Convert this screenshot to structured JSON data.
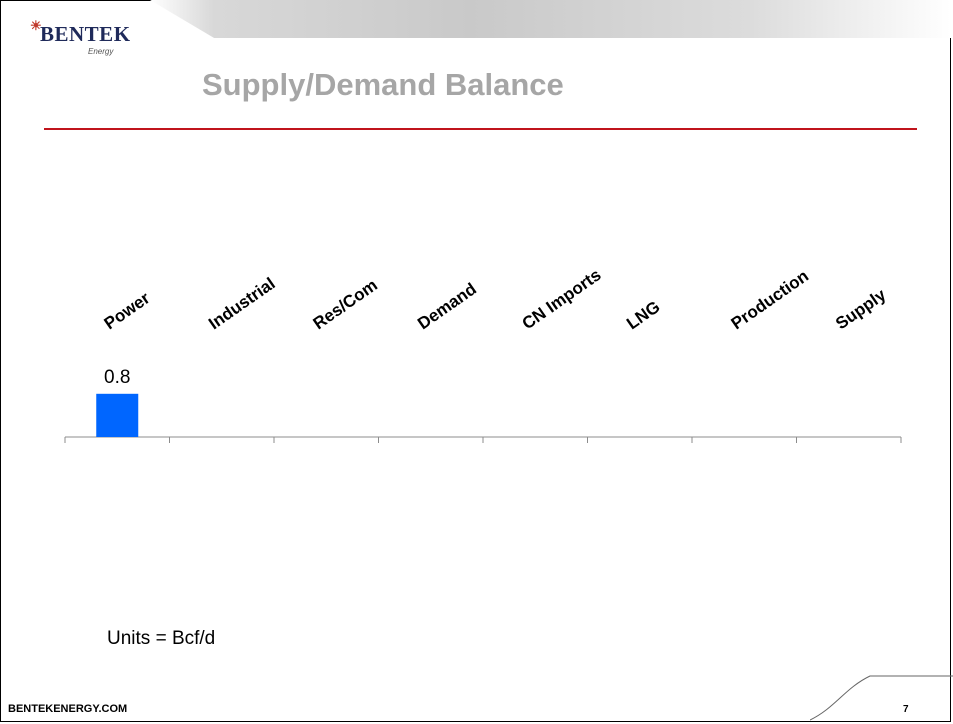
{
  "slide": {
    "logo_word": "BENTEK",
    "logo_sub": "Energy",
    "title": "Supply/Demand Balance",
    "units": "Units = Bcf/d",
    "footer_url": "BENTEKENERGY.COM",
    "page_number": "7"
  },
  "colors": {
    "bar": "#0066ff",
    "title": "#a6a6a6",
    "rule": "#c0141c"
  },
  "chart_data": {
    "type": "bar",
    "categories": [
      "Power",
      "Industrial",
      "Res/Com",
      "Demand",
      "CN Imports",
      "LNG",
      "Production",
      "Supply"
    ],
    "values": [
      0.8,
      null,
      null,
      null,
      null,
      null,
      null,
      null
    ],
    "data_labels": [
      "0.8",
      "",
      "",
      "",
      "",
      "",
      "",
      ""
    ],
    "title": "",
    "xlabel": "",
    "ylabel": "",
    "ylim": [
      0,
      1
    ],
    "grid": false,
    "legend": "none"
  }
}
